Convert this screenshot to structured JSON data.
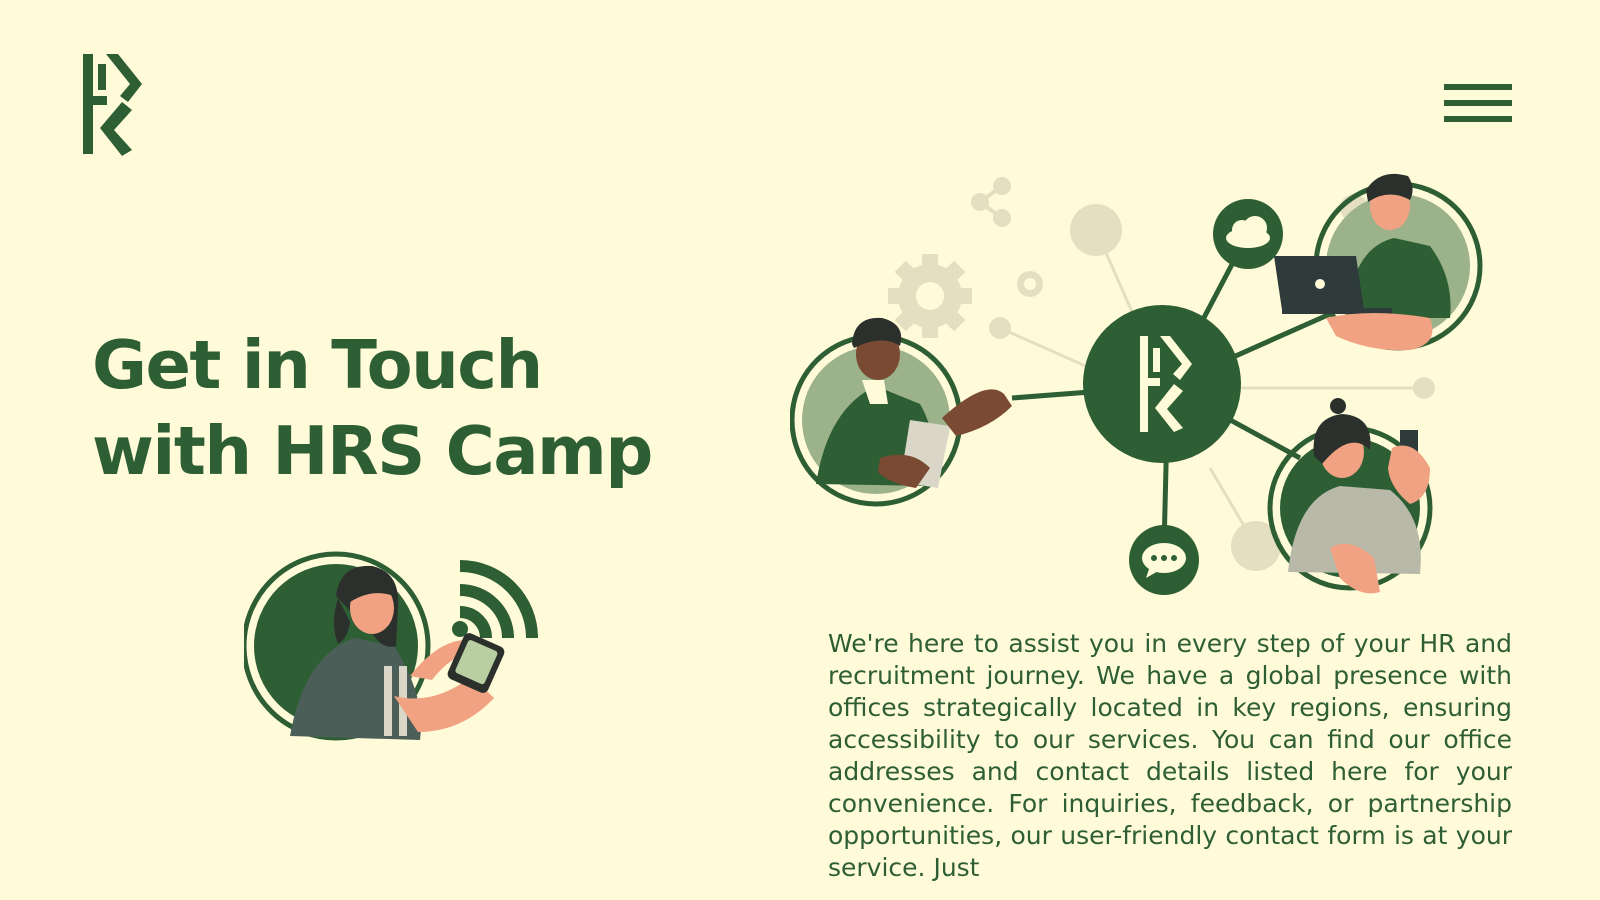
{
  "header": {
    "logo_icon": "hrs-camp-logo-icon",
    "menu_icon": "hamburger-menu-icon"
  },
  "hero": {
    "title_line1": "Get in Touch",
    "title_line2": "with HRS Camp"
  },
  "illustrations": {
    "left": "person-with-phone-illustration",
    "right": "hr-network-illustration",
    "network_icons": [
      "cloud-icon",
      "chat-bubble-icon",
      "share-icon",
      "gear-icon"
    ]
  },
  "intro": {
    "text": "We're here to assist you in every step of your HR and recruitment journey. We have a global presence with offices strategically located in key regions, ensuring accessibility to our services. You can find our office addresses and contact details listed here for your convenience. For inquiries, feedback, or partnership opportunities, our user-friendly contact form is at your service. Just"
  },
  "colors": {
    "background": "#FFFBD9",
    "primary": "#2E5E34",
    "light_green": "#9BB28A",
    "skin": "#F0A283",
    "muted": "#ECE7C6"
  }
}
